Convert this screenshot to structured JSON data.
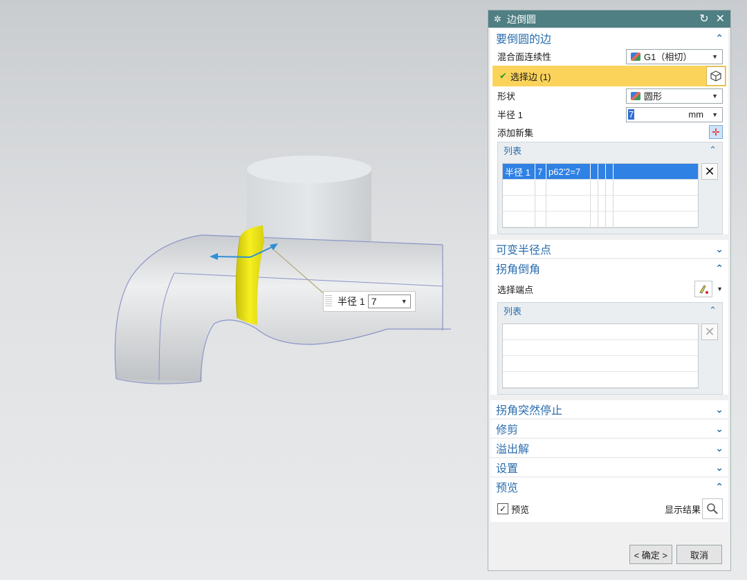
{
  "viewport": {
    "onscreen_label": "半径 1",
    "onscreen_value": "7"
  },
  "dialog": {
    "title": "边倒圆",
    "sections": {
      "edge": {
        "title": "要倒圆的边",
        "continuity_label": "混合面连续性",
        "continuity_value": "G1（相切）",
        "select_label": "选择边 (1)",
        "shape_label": "形状",
        "shape_value": "圆形",
        "radius_label": "半径 1",
        "radius_value": "7",
        "radius_unit": "mm",
        "add_set_label": "添加新集",
        "list_title": "列表",
        "list_rows": [
          {
            "c1": "半径 1",
            "c2": "7",
            "c3": "p62'2=7",
            "c4": "",
            "c5": "",
            "c6": "",
            "c7": ""
          },
          {
            "c1": "",
            "c2": "",
            "c3": "",
            "c4": "",
            "c5": "",
            "c6": "",
            "c7": ""
          },
          {
            "c1": "",
            "c2": "",
            "c3": "",
            "c4": "",
            "c5": "",
            "c6": "",
            "c7": ""
          },
          {
            "c1": "",
            "c2": "",
            "c3": "",
            "c4": "",
            "c5": "",
            "c6": "",
            "c7": ""
          }
        ]
      },
      "variable": {
        "title": "可变半径点"
      },
      "corner": {
        "title": "拐角倒角",
        "pick_label": "选择端点",
        "list_title": "列表"
      },
      "corner_stop": {
        "title": "拐角突然停止"
      },
      "trim": {
        "title": "修剪"
      },
      "overflow": {
        "title": "溢出解"
      },
      "settings": {
        "title": "设置"
      },
      "preview": {
        "title": "预览",
        "checkbox_label": "预览",
        "show_result_label": "显示结果"
      }
    },
    "buttons": {
      "ok": "< 确定 >",
      "cancel": "取消"
    }
  },
  "colors": {
    "titlebar": "#4f7f83",
    "section_title": "#2a6eae",
    "selection_row": "#fbd35b",
    "list_selection": "#2f81e4",
    "fillet_face": "#f2ea16"
  }
}
